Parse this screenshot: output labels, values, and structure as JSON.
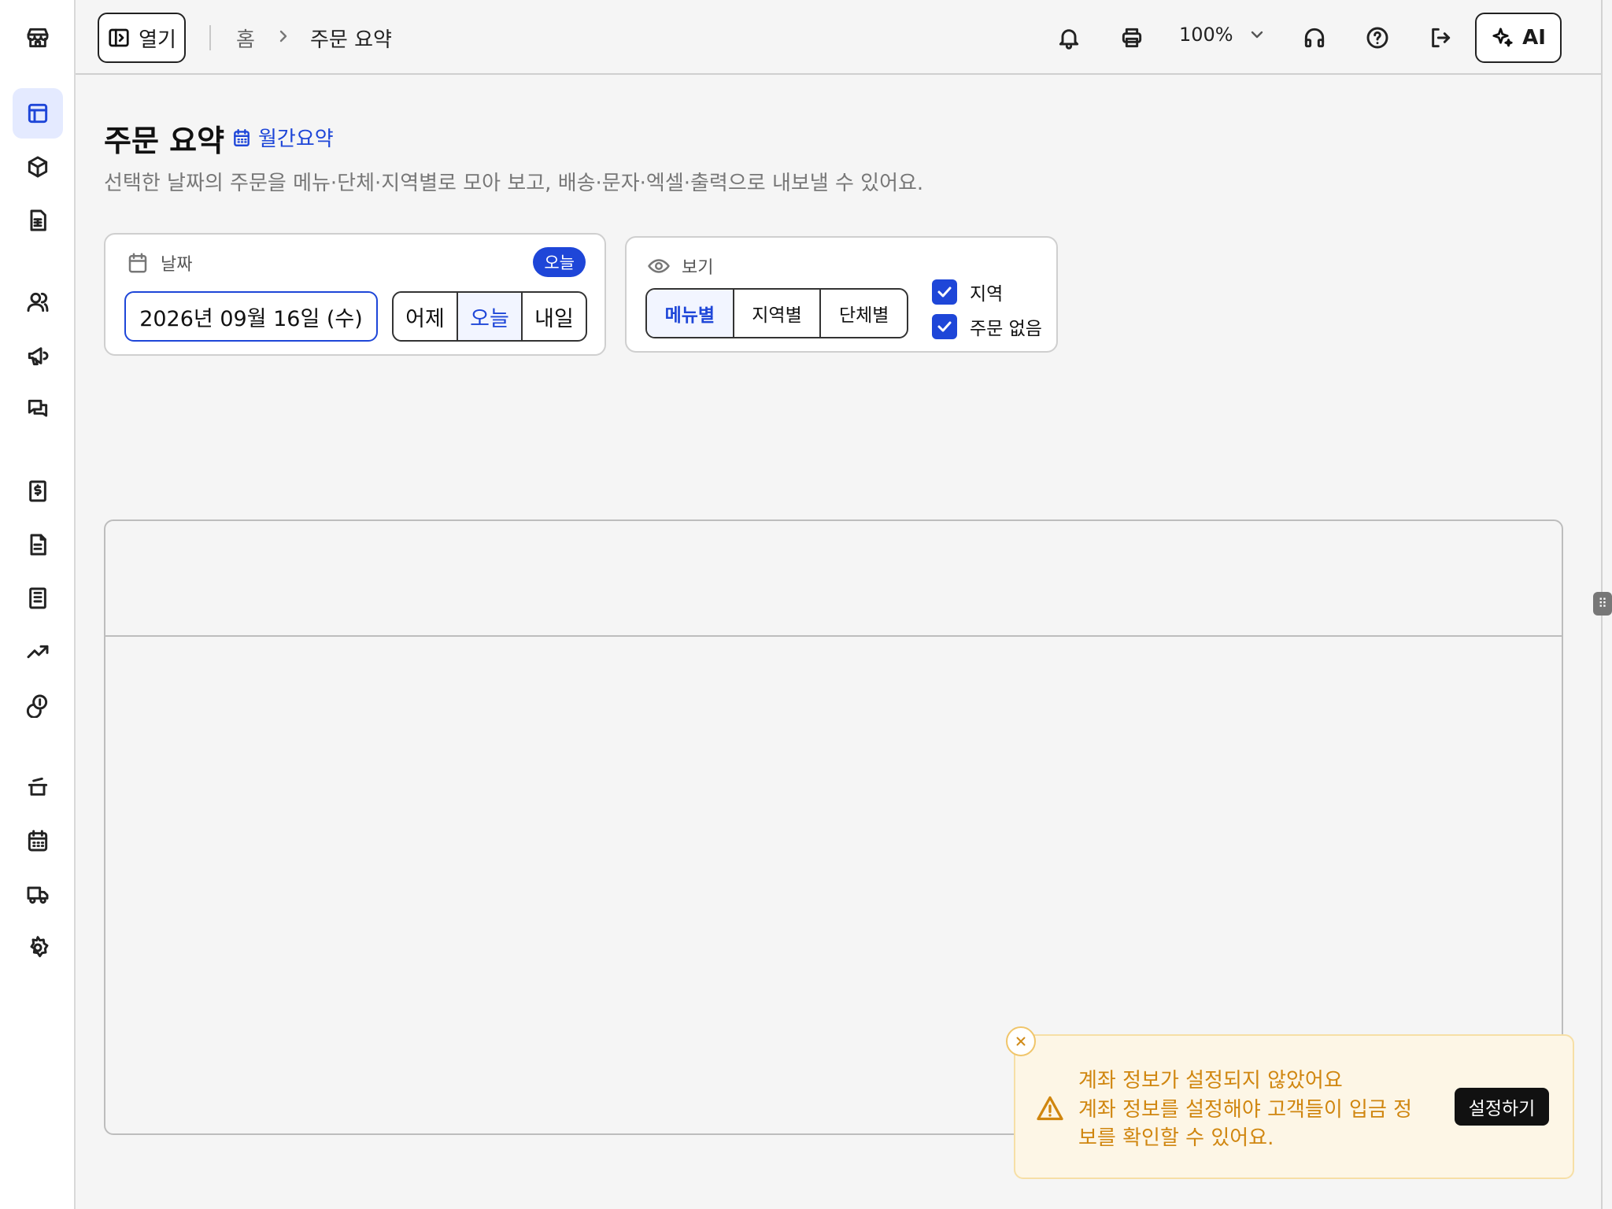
{
  "topbar": {
    "open_label": "열기",
    "breadcrumb_home": "홈",
    "breadcrumb_current": "주문 요약",
    "zoom": "100%",
    "ai_label": "AI"
  },
  "sidebar": {
    "items": [
      {
        "icon": "store-icon",
        "active": false
      },
      {
        "icon": "layout-icon",
        "active": true
      },
      {
        "icon": "box-icon",
        "active": false
      },
      {
        "icon": "document-sheet-icon",
        "active": false
      },
      {
        "icon": "users-icon",
        "active": false
      },
      {
        "icon": "megaphone-icon",
        "active": false
      },
      {
        "icon": "chat-icon",
        "active": false
      },
      {
        "icon": "receipt-dollar-icon",
        "active": false
      },
      {
        "icon": "file-text-icon",
        "active": false
      },
      {
        "icon": "list-icon",
        "active": false
      },
      {
        "icon": "trending-up-icon",
        "active": false
      },
      {
        "icon": "coins-icon",
        "active": false
      },
      {
        "icon": "pot-icon",
        "active": false
      },
      {
        "icon": "calendar-icon",
        "active": false
      },
      {
        "icon": "truck-icon",
        "active": false
      },
      {
        "icon": "gear-icon",
        "active": false
      }
    ]
  },
  "page": {
    "title": "주문 요약",
    "monthly_link": "월간요약",
    "description": "선택한 날짜의 주문을 메뉴·단체·지역별로 모아 보고, 배송·문자·엑셀·출력으로 내보낼 수 있어요."
  },
  "date_card": {
    "label": "날짜",
    "badge": "오늘",
    "date_value": "2026년 09월 16일 (수)",
    "buttons": [
      "어제",
      "오늘",
      "내일"
    ],
    "selected": "오늘"
  },
  "view_card": {
    "label": "보기",
    "buttons": [
      "메뉴별",
      "지역별",
      "단체별"
    ],
    "selected": "메뉴별",
    "checkboxes": [
      {
        "label": "지역",
        "checked": true
      },
      {
        "label": "주문 없음",
        "checked": true
      }
    ]
  },
  "toast": {
    "title": "계좌 정보가 설정되지 않았어요",
    "message": "계좌 정보를 설정해야 고객들이 입금 정보를 확인할 수 있어요.",
    "action": "설정하기"
  },
  "colors": {
    "accent": "#1e46d8",
    "warning": "#d0860f",
    "toast_bg": "#fdf6e6"
  }
}
